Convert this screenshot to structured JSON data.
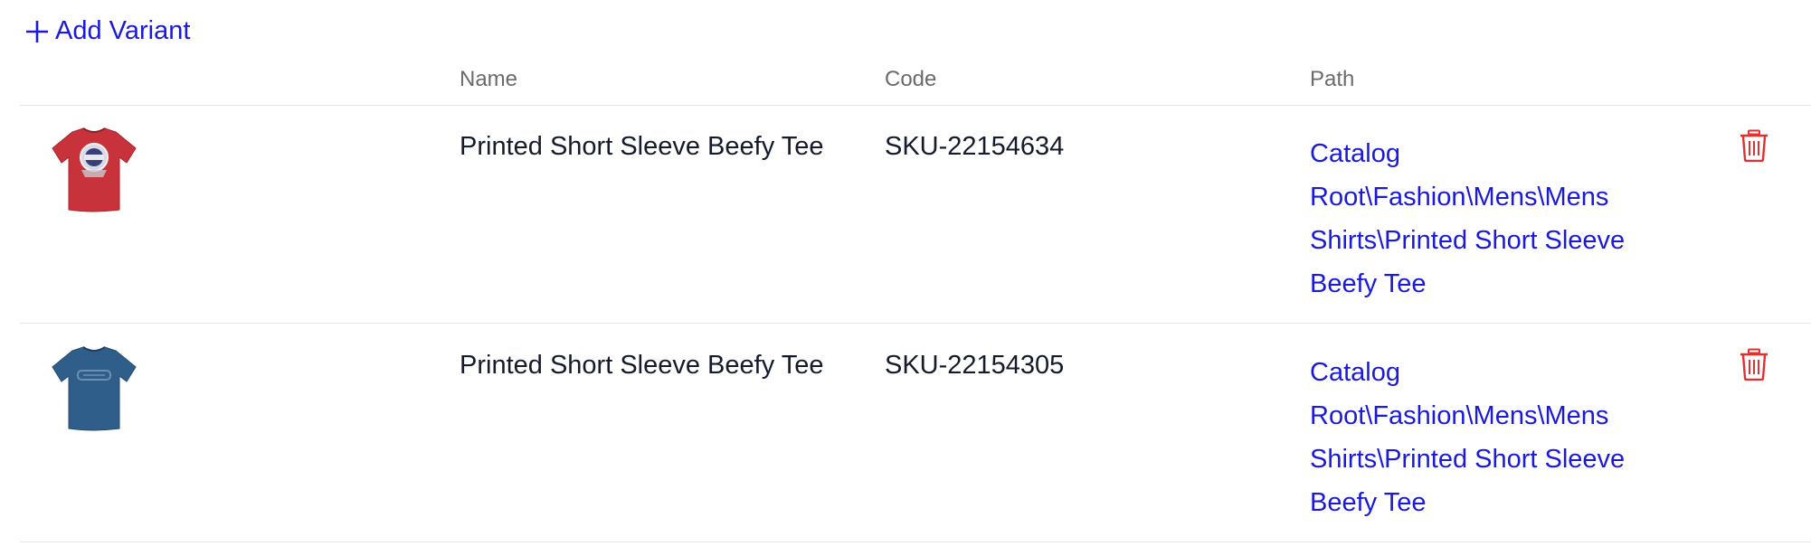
{
  "toolbar": {
    "add_variant_label": "Add Variant"
  },
  "table": {
    "columns": [
      "Name",
      "Code",
      "Path"
    ],
    "rows": [
      {
        "image": "red-tshirt-thumbnail",
        "name": "Printed Short Sleeve Beefy Tee",
        "code": "SKU-22154634",
        "path_lines": [
          "Catalog",
          "Root\\Fashion\\Mens\\Mens",
          "Shirts\\Printed Short Sleeve",
          "Beefy Tee"
        ]
      },
      {
        "image": "blue-tshirt-thumbnail",
        "name": "Printed Short Sleeve Beefy Tee",
        "code": "SKU-22154305",
        "path_lines": [
          "Catalog",
          "Root\\Fashion\\Mens\\Mens",
          "Shirts\\Printed Short Sleeve",
          "Beefy Tee"
        ]
      }
    ]
  },
  "colors": {
    "link": "#1a1ad8",
    "delete": "#e03131",
    "text": "#151a2c",
    "header_text": "#6b6b6b",
    "tshirt_red": "#c8323a",
    "tshirt_blue": "#2f5e8a"
  },
  "icons": {
    "add": "plus-icon",
    "delete": "trash-icon"
  }
}
